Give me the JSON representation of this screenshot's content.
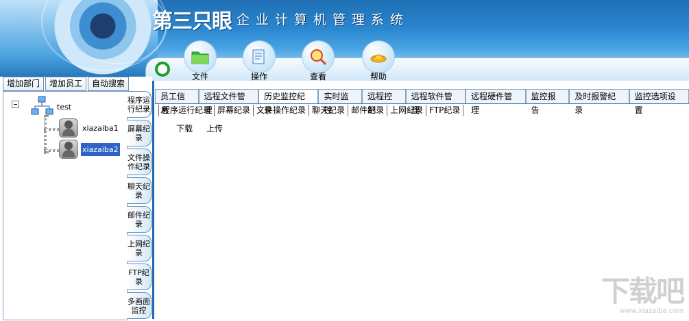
{
  "header": {
    "brand": "第三只眼",
    "subtitle": "企业计算机管理系统"
  },
  "toolbar": {
    "items": [
      {
        "label": "文件",
        "icon": "folder-icon"
      },
      {
        "label": "操作",
        "icon": "document-icon"
      },
      {
        "label": "查看",
        "icon": "magnifier-icon"
      },
      {
        "label": "帮助",
        "icon": "lamp-icon"
      }
    ]
  },
  "left": {
    "buttons": [
      "增加部门",
      "增加员工",
      "自动搜索"
    ],
    "tree": {
      "root": "test",
      "children": [
        "xiazaiba1",
        "xiazaiba2"
      ]
    },
    "side_tabs": [
      "程序运行纪录",
      "屏幕纪录",
      "文件操作纪录",
      "聊天纪录",
      "邮件纪录",
      "上网纪录",
      "FTP纪录",
      "多画面监控"
    ]
  },
  "main_tabs": [
    "员工信息",
    "远程文件管理",
    "历史监控纪录",
    "实时监控",
    "远程控制",
    "远程软件管理",
    "远程硬件管理",
    "监控报告",
    "及时报警纪录",
    "监控选项设置"
  ],
  "sub_tabs": [
    "程序运行纪录",
    "屏幕纪录",
    "文件操作纪录",
    "聊天纪录",
    "邮件纪录",
    "上网纪录",
    "FTP纪录"
  ],
  "actions": [
    "下载",
    "上传"
  ],
  "watermark": {
    "main": "下载吧",
    "url": "www.xiazaiba.com"
  }
}
